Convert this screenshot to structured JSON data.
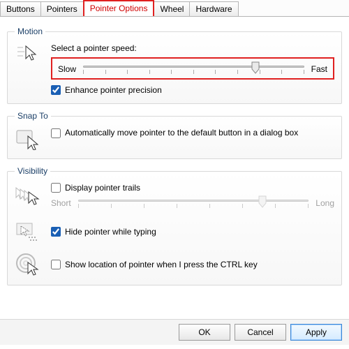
{
  "tabs": [
    "Buttons",
    "Pointers",
    "Pointer Options",
    "Wheel",
    "Hardware"
  ],
  "active_tab_index": 2,
  "motion": {
    "legend": "Motion",
    "label": "Select a pointer speed:",
    "slow": "Slow",
    "fast": "Fast",
    "speed_percent": 78,
    "enhance_label": "Enhance pointer precision",
    "enhance_checked": true
  },
  "snap": {
    "legend": "Snap To",
    "auto_label": "Automatically move pointer to the default button in a dialog box",
    "auto_checked": false
  },
  "visibility": {
    "legend": "Visibility",
    "trails_label": "Display pointer trails",
    "trails_checked": false,
    "trails_short": "Short",
    "trails_long": "Long",
    "trails_percent": 80,
    "hide_label": "Hide pointer while typing",
    "hide_checked": true,
    "show_label": "Show location of pointer when I press the CTRL key",
    "show_checked": false
  },
  "buttons": {
    "ok": "OK",
    "cancel": "Cancel",
    "apply": "Apply"
  }
}
